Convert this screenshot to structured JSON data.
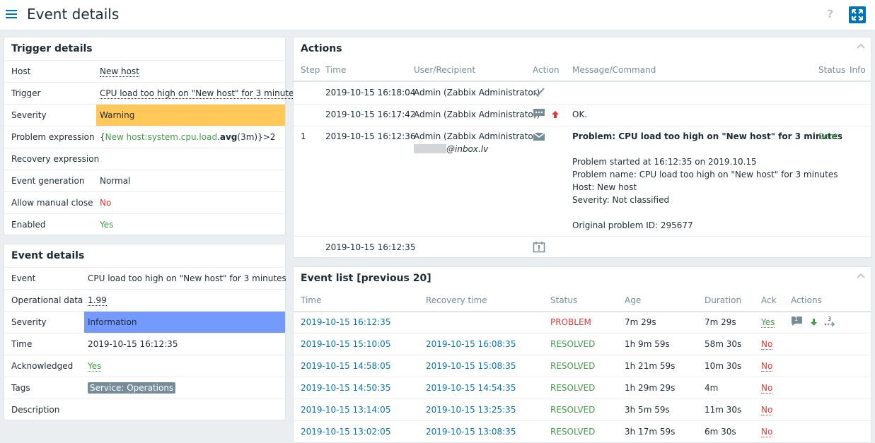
{
  "header": {
    "title": "Event details",
    "help": "?"
  },
  "trigger_details": {
    "title": "Trigger details",
    "rows": [
      {
        "label": "Host",
        "value": "New host"
      },
      {
        "label": "Trigger",
        "value": "CPU load too high on \"New host\" for 3 minutes"
      },
      {
        "label": "Severity",
        "value": "Warning",
        "color": "#ffc859"
      },
      {
        "label": "Problem expression",
        "expr": {
          "open": "{",
          "item": "New host:system.cpu.load",
          "dot": ".",
          "func": "avg",
          "args": "(3m)",
          "rest": "}>2"
        }
      },
      {
        "label": "Recovery expression",
        "value": ""
      },
      {
        "label": "Event generation",
        "value": "Normal"
      },
      {
        "label": "Allow manual close",
        "value": "No"
      },
      {
        "label": "Enabled",
        "value": "Yes"
      }
    ]
  },
  "event_details": {
    "title": "Event details",
    "rows": [
      {
        "label": "Event",
        "value": "CPU load too high on \"New host\" for 3 minutes"
      },
      {
        "label": "Operational data",
        "value": "1.99"
      },
      {
        "label": "Severity",
        "value": "Information",
        "color": "#7499ff"
      },
      {
        "label": "Time",
        "value": "2019-10-15 16:12:35"
      },
      {
        "label": "Acknowledged",
        "value": "Yes"
      },
      {
        "label": "Tags",
        "value": "Service: Operations"
      },
      {
        "label": "Description",
        "value": ""
      }
    ]
  },
  "actions": {
    "title": "Actions",
    "columns": [
      "Step",
      "Time",
      "User/Recipient",
      "Action",
      "Message/Command",
      "Status",
      "Info"
    ],
    "rows": [
      {
        "step": "",
        "time": "2019-10-15 16:18:04",
        "user": "Admin (Zabbix Administrator)",
        "icon": "check-icon",
        "message": "",
        "status": ""
      },
      {
        "step": "",
        "time": "2019-10-15 16:17:42",
        "user": "Admin (Zabbix Administrator)",
        "icon": "message-icon",
        "message": "OK.",
        "status": ""
      },
      {
        "step": "1",
        "time": "2019-10-15 16:12:36",
        "user": "Admin (Zabbix Administrator)",
        "email": "@inbox.lv",
        "icon": "envelope-icon",
        "message_title": "Problem: CPU load too high on \"New host\" for 3 minutes",
        "message_lines": [
          "Problem started at 16:12:35 on 2019.10.15",
          "Problem name: CPU load too high on \"New host\" for 3 minutes",
          "Host: New host",
          "Severity: Not classified",
          "",
          "Original problem ID: 295677"
        ],
        "status": "Sent"
      },
      {
        "step": "",
        "time": "2019-10-15 16:12:35",
        "user": "",
        "icon": "calendar-icon",
        "message": "",
        "status": ""
      }
    ]
  },
  "event_list": {
    "title": "Event list [previous 20]",
    "columns": [
      "Time",
      "Recovery time",
      "Status",
      "Age",
      "Duration",
      "Ack",
      "Actions"
    ],
    "rows": [
      {
        "time": "2019-10-15 16:12:35",
        "recovery": "",
        "status": "PROBLEM",
        "age": "7m 29s",
        "duration": "7m 29s",
        "ack": "Yes",
        "actions_count": "1",
        "actions_sub": "3"
      },
      {
        "time": "2019-10-15 15:10:05",
        "recovery": "2019-10-15 16:08:35",
        "status": "RESOLVED",
        "age": "1h 9m 59s",
        "duration": "58m 30s",
        "ack": "No"
      },
      {
        "time": "2019-10-15 14:58:05",
        "recovery": "2019-10-15 15:08:35",
        "status": "RESOLVED",
        "age": "1h 21m 59s",
        "duration": "10m 30s",
        "ack": "No"
      },
      {
        "time": "2019-10-15 14:50:35",
        "recovery": "2019-10-15 14:54:35",
        "status": "RESOLVED",
        "age": "1h 29m 29s",
        "duration": "4m",
        "ack": "No"
      },
      {
        "time": "2019-10-15 13:14:05",
        "recovery": "2019-10-15 13:25:35",
        "status": "RESOLVED",
        "age": "3h 5m 59s",
        "duration": "11m 30s",
        "ack": "No"
      },
      {
        "time": "2019-10-15 13:02:05",
        "recovery": "2019-10-15 13:08:35",
        "status": "RESOLVED",
        "age": "3h 17m 59s",
        "duration": "6m 30s",
        "ack": "No"
      }
    ]
  },
  "colors": {
    "accent": "#0275b8",
    "ok": "#429e47",
    "problem": "#e33734"
  }
}
